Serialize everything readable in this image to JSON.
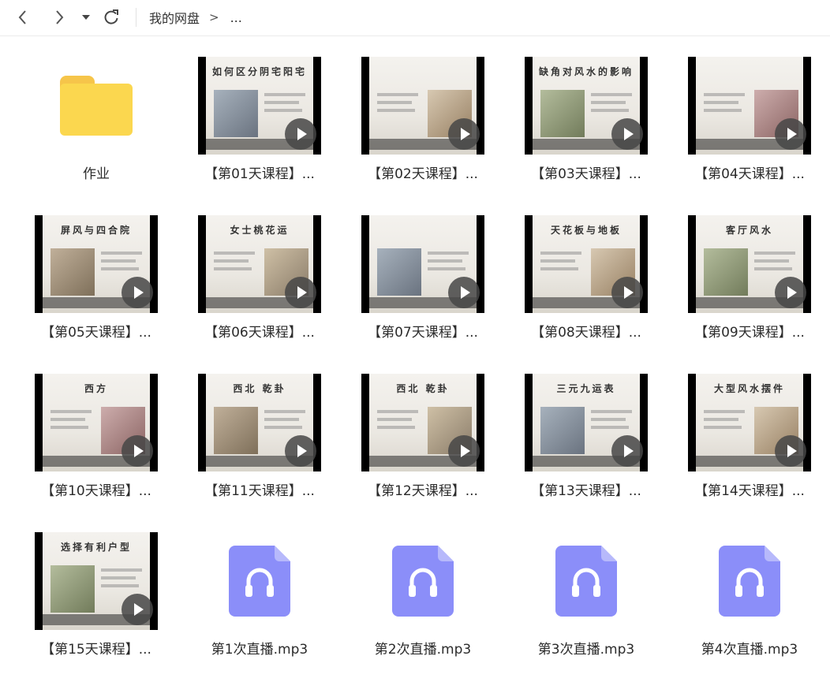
{
  "toolbar": {
    "back_icon": "chevron-left-icon",
    "forward_icon": "chevron-right-icon",
    "history_icon": "caret-down-icon",
    "refresh_icon": "refresh-icon",
    "breadcrumb_root": "我的网盘",
    "breadcrumb_separator": ">",
    "breadcrumb_more": "..."
  },
  "colors": {
    "folder": "#fbd74f",
    "audio_icon": "#8b8ef9",
    "play_overlay": "#464646"
  },
  "files": [
    {
      "type": "folder",
      "label": "作业",
      "icon": "folder-icon"
    },
    {
      "type": "video",
      "label": "【第01天课程】...",
      "thumb_title": "如何区分阴宅阳宅"
    },
    {
      "type": "video",
      "label": "【第02天课程】...",
      "thumb_title": ""
    },
    {
      "type": "video",
      "label": "【第03天课程】...",
      "thumb_title": "缺角对风水的影响"
    },
    {
      "type": "video",
      "label": "【第04天课程】...",
      "thumb_title": ""
    },
    {
      "type": "video",
      "label": "【第05天课程】...",
      "thumb_title": "屏风与四合院"
    },
    {
      "type": "video",
      "label": "【第06天课程】...",
      "thumb_title": "女士桃花运"
    },
    {
      "type": "video",
      "label": "【第07天课程】...",
      "thumb_title": ""
    },
    {
      "type": "video",
      "label": "【第08天课程】...",
      "thumb_title": "天花板与地板"
    },
    {
      "type": "video",
      "label": "【第09天课程】...",
      "thumb_title": "客厅风水"
    },
    {
      "type": "video",
      "label": "【第10天课程】...",
      "thumb_title": "西方"
    },
    {
      "type": "video",
      "label": "【第11天课程】...",
      "thumb_title": "西北 乾卦"
    },
    {
      "type": "video",
      "label": "【第12天课程】...",
      "thumb_title": "西北 乾卦"
    },
    {
      "type": "video",
      "label": "【第13天课程】...",
      "thumb_title": "三元九运表"
    },
    {
      "type": "video",
      "label": "【第14天课程】...",
      "thumb_title": "大型风水摆件"
    },
    {
      "type": "video",
      "label": "【第15天课程】...",
      "thumb_title": "选择有利户型"
    },
    {
      "type": "audio",
      "label": "第1次直播.mp3",
      "icon": "headphones-icon"
    },
    {
      "type": "audio",
      "label": "第2次直播.mp3",
      "icon": "headphones-icon"
    },
    {
      "type": "audio",
      "label": "第3次直播.mp3",
      "icon": "headphones-icon"
    },
    {
      "type": "audio",
      "label": "第4次直播.mp3",
      "icon": "headphones-icon"
    }
  ]
}
